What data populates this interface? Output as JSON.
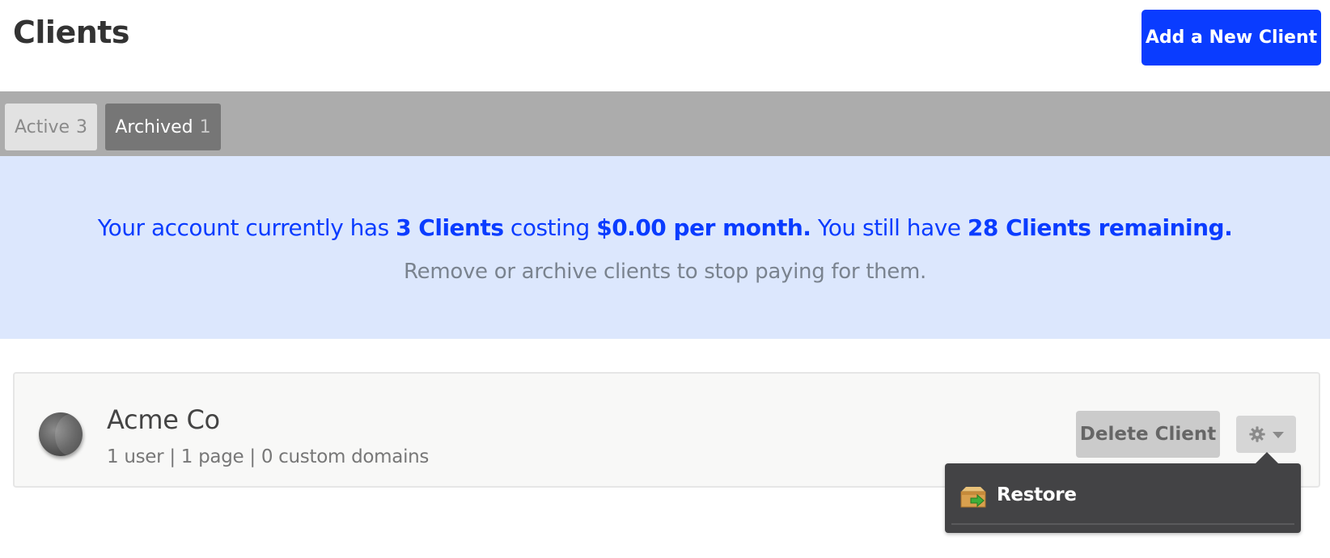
{
  "header": {
    "title": "Clients",
    "add_button_label": "Add a New Client"
  },
  "tabs": [
    {
      "label": "Active",
      "count": "3"
    },
    {
      "label": "Archived",
      "count": "1"
    }
  ],
  "notice": {
    "prefix": "Your account currently has",
    "clients_count": "3 Clients",
    "costing": "costing",
    "cost": "$0.00 per month.",
    "still_have": "You still have",
    "remaining": "28 Clients remaining.",
    "subtext": "Remove or archive clients to stop paying for them."
  },
  "client": {
    "name": "Acme Co",
    "meta": "1 user | 1 page | 0 custom domains",
    "delete_label": "Delete Client"
  },
  "dropdown": {
    "items": [
      {
        "label": "Restore",
        "icon": "restore-box-icon"
      }
    ]
  },
  "colors": {
    "accent": "#0a3cff",
    "notice_bg": "#dce7fd",
    "tabbar_bg": "#acacac",
    "dropdown_bg": "#434345"
  }
}
